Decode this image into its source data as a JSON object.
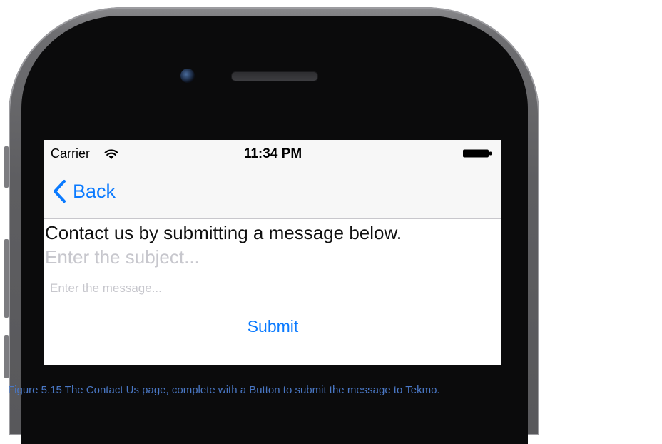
{
  "status_bar": {
    "carrier": "Carrier",
    "time": "11:34 PM",
    "wifi_icon": "wifi-icon",
    "battery_icon": "battery-icon"
  },
  "nav": {
    "back_label": "Back",
    "back_icon": "chevron-left-icon"
  },
  "content": {
    "heading": "Contact us by submitting a message below.",
    "subject_placeholder": "Enter the subject...",
    "subject_value": "",
    "message_placeholder": "Enter the message...",
    "message_value": "",
    "submit_label": "Submit"
  },
  "caption": "Figure 5.15 The Contact Us page, complete with a Button to submit the message to Tekmo.",
  "colors": {
    "accent": "#0a7aff",
    "caption": "#4a78c6",
    "placeholder": "#c7c7cd",
    "phone_body": "#5e5e61",
    "phone_face": "#0b0b0c"
  }
}
